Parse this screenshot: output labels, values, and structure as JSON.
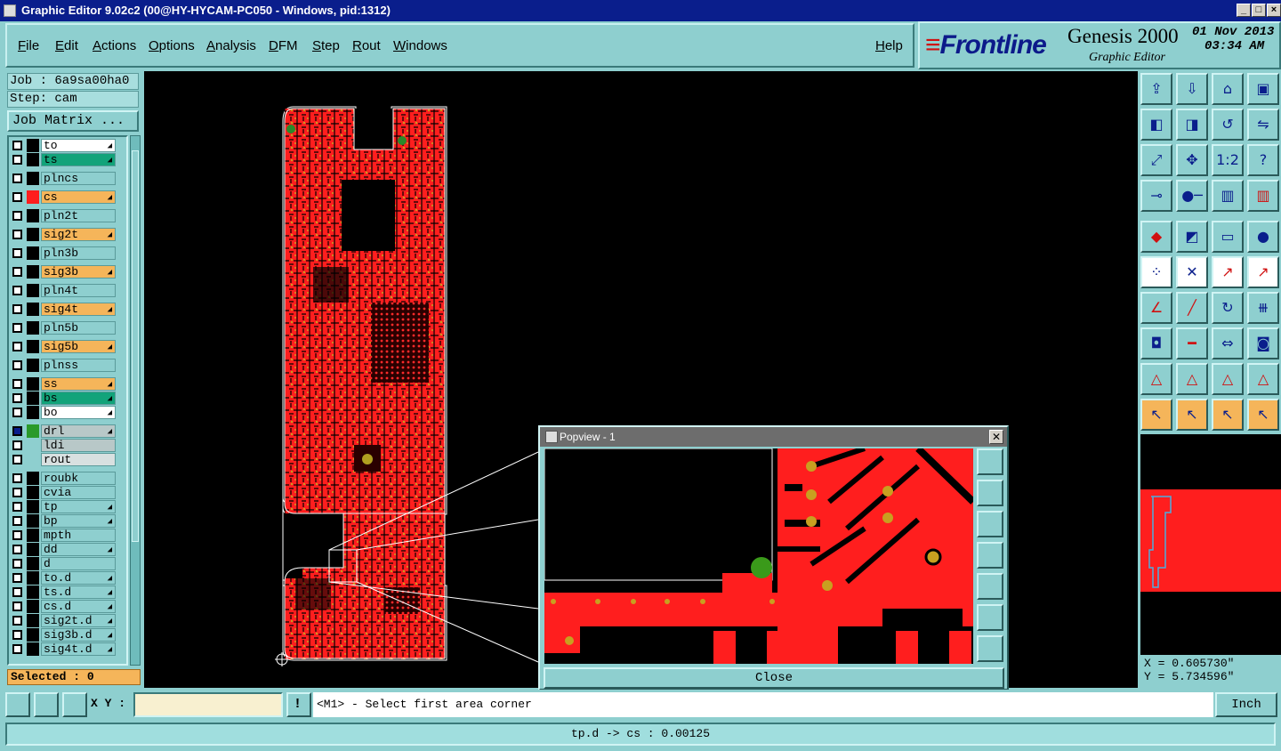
{
  "window": {
    "title": "Graphic Editor 9.02c2 (00@HY-HYCAM-PC050 - Windows, pid:1312)"
  },
  "menu": [
    "File",
    "Edit",
    "Actions",
    "Options",
    "Analysis",
    "DFM",
    "Step",
    "Rout",
    "Windows"
  ],
  "help": "Help",
  "brand": {
    "logo": "Frontline",
    "product": "Genesis 2000",
    "subtitle": "Graphic Editor",
    "date": "01 Nov 2013",
    "time": "03:34 AM"
  },
  "job": {
    "job_line": "Job : 6a9sa00ha0",
    "step_line": "Step: cam",
    "matrix_button": "Job Matrix ..."
  },
  "layers": [
    {
      "name": "to",
      "bg": "#ffffff",
      "swatch": "#000000",
      "arrow": true
    },
    {
      "name": "ts",
      "bg": "#12a37a",
      "swatch": "#000000",
      "arrow": true
    },
    {
      "name": "plncs",
      "bg": "#8ecfcf",
      "swatch": "#000000",
      "arrow": false
    },
    {
      "name": "cs",
      "bg": "#f5b55a",
      "swatch": "#ff1e1e",
      "arrow": true
    },
    {
      "name": "pln2t",
      "bg": "#8ecfcf",
      "swatch": "#000000",
      "arrow": false
    },
    {
      "name": "sig2t",
      "bg": "#f5b55a",
      "swatch": "#000000",
      "arrow": true
    },
    {
      "name": "pln3b",
      "bg": "#8ecfcf",
      "swatch": "#000000",
      "arrow": false
    },
    {
      "name": "sig3b",
      "bg": "#f5b55a",
      "swatch": "#000000",
      "arrow": true
    },
    {
      "name": "pln4t",
      "bg": "#8ecfcf",
      "swatch": "#000000",
      "arrow": false
    },
    {
      "name": "sig4t",
      "bg": "#f5b55a",
      "swatch": "#000000",
      "arrow": true
    },
    {
      "name": "pln5b",
      "bg": "#8ecfcf",
      "swatch": "#000000",
      "arrow": false
    },
    {
      "name": "sig5b",
      "bg": "#f5b55a",
      "swatch": "#000000",
      "arrow": true
    },
    {
      "name": "plnss",
      "bg": "#8ecfcf",
      "swatch": "#000000",
      "arrow": false
    },
    {
      "name": "ss",
      "bg": "#f5b55a",
      "swatch": "#000000",
      "arrow": true
    },
    {
      "name": "bs",
      "bg": "#12a37a",
      "swatch": "#000000",
      "arrow": true
    },
    {
      "name": "bo",
      "bg": "#ffffff",
      "swatch": "#000000",
      "arrow": true
    },
    {
      "name": "drl",
      "bg": "#b8c8c8",
      "swatch": "#2a9a2a",
      "arrow": true,
      "checked_dark": true
    },
    {
      "name": "ldi",
      "bg": "#b8c8c8",
      "swatch": "#8ecfcf",
      "arrow": false
    },
    {
      "name": "rout",
      "bg": "#d8e0e0",
      "swatch": "#8ecfcf",
      "arrow": false
    },
    {
      "name": "roubk",
      "bg": "#8ecfcf",
      "swatch": "#000000",
      "arrow": false
    },
    {
      "name": "cvia",
      "bg": "#8ecfcf",
      "swatch": "#000000",
      "arrow": false
    },
    {
      "name": "tp",
      "bg": "#8ecfcf",
      "swatch": "#000000",
      "arrow": true
    },
    {
      "name": "bp",
      "bg": "#8ecfcf",
      "swatch": "#000000",
      "arrow": true
    },
    {
      "name": "mpth",
      "bg": "#8ecfcf",
      "swatch": "#000000",
      "arrow": false
    },
    {
      "name": "dd",
      "bg": "#8ecfcf",
      "swatch": "#000000",
      "arrow": true
    },
    {
      "name": "d",
      "bg": "#8ecfcf",
      "swatch": "#000000",
      "arrow": false
    },
    {
      "name": "to.d",
      "bg": "#8ecfcf",
      "swatch": "#000000",
      "arrow": true
    },
    {
      "name": "ts.d",
      "bg": "#8ecfcf",
      "swatch": "#000000",
      "arrow": true
    },
    {
      "name": "cs.d",
      "bg": "#8ecfcf",
      "swatch": "#000000",
      "arrow": true
    },
    {
      "name": "sig2t.d",
      "bg": "#8ecfcf",
      "swatch": "#000000",
      "arrow": true
    },
    {
      "name": "sig3b.d",
      "bg": "#8ecfcf",
      "swatch": "#000000",
      "arrow": true
    },
    {
      "name": "sig4t.d",
      "bg": "#8ecfcf",
      "swatch": "#000000",
      "arrow": true
    }
  ],
  "selected": "Selected : 0",
  "popview": {
    "title": "Popview - 1",
    "close_label": "Close"
  },
  "toolbox_icons": [
    "open-step-icon",
    "save-icon",
    "home-icon",
    "window-icon",
    "previous-icon",
    "next-icon",
    "undo-icon",
    "redo-icon",
    "fit-all-icon",
    "zoom-fit-icon",
    "one-to-one-icon",
    "help-icon",
    "measure-tool-icon",
    "pin-icon",
    "layer-red-icon",
    "layer-blue-icon",
    "pad-icon",
    "slash-icon",
    "ruler-icon",
    "dot-icon",
    "connect-icon",
    "cross-icon",
    "move-node-icon",
    "node-pair-icon",
    "angle-icon",
    "line-icon",
    "arc-icon",
    "text-f-icon",
    "pad-swap-icon",
    "line-cut-icon",
    "size-icon",
    "copy-icon",
    "triangle-a-icon",
    "triangle-b-icon",
    "triangle-c-icon",
    "triangle-d-icon",
    "select-arrow-icon",
    "select-box-icon",
    "select-diamond-icon",
    "select-path-icon"
  ],
  "coords": {
    "x": "X = 0.605730\"",
    "y": "Y = 5.734596\""
  },
  "cmdbar": {
    "xy_label": "X Y :",
    "prompt": "<M1> - Select first area corner",
    "units": "Inch"
  },
  "status": "tp.d -> cs : 0.00125",
  "colors": {
    "panel": "#8ecfcf",
    "copper": "#ff1e1e",
    "canvas": "#000000",
    "title": "#0a1e8c"
  }
}
